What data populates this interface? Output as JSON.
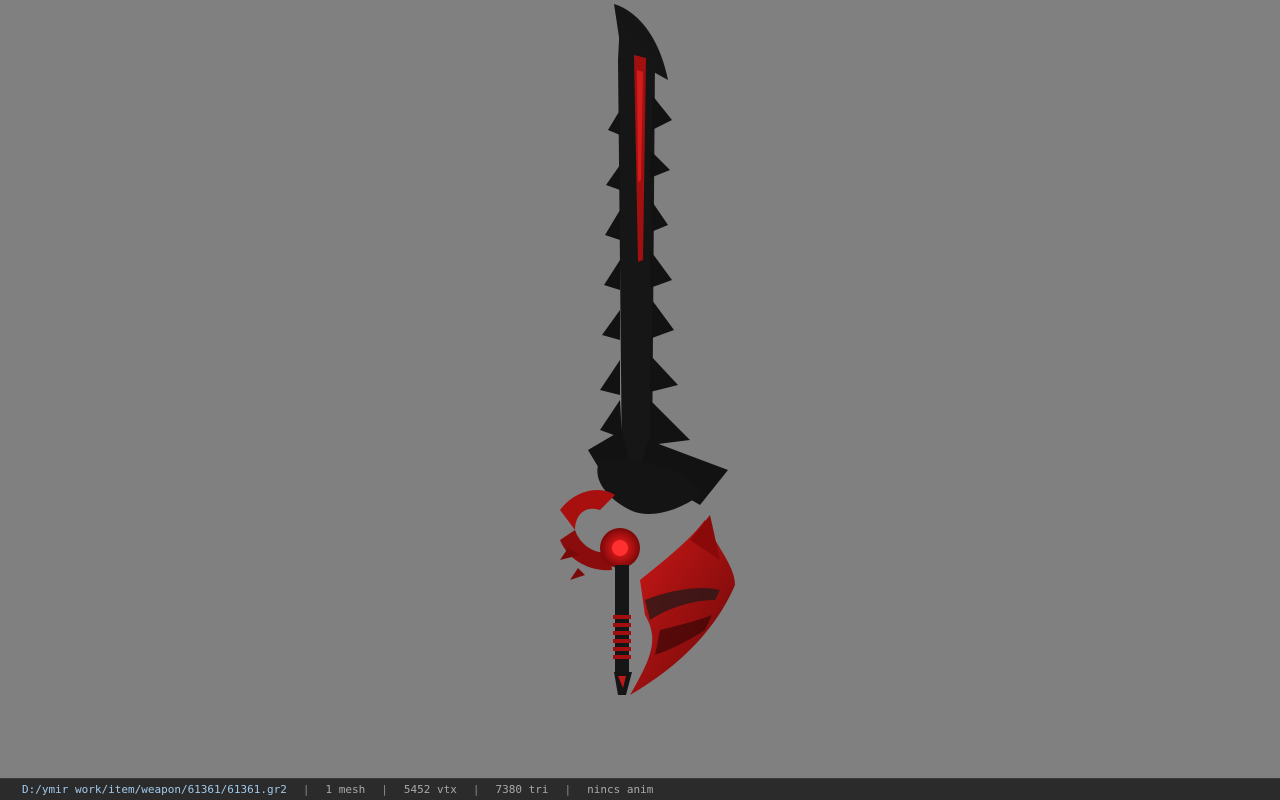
{
  "status_bar": {
    "file_path": "D:/ymir work/item/weapon/61361/61361.gr2",
    "separator": "|",
    "mesh_count": "1 mesh",
    "vertex_count": "5452 vtx",
    "triangle_count": "7380 tri",
    "anim_info": "nincs anim"
  },
  "colors": {
    "viewport_background": "#808080",
    "status_bar_background": "#2b2b2b",
    "path_text": "#9fc8ea",
    "blade_black": "#141414",
    "blade_red": "#b01010"
  }
}
